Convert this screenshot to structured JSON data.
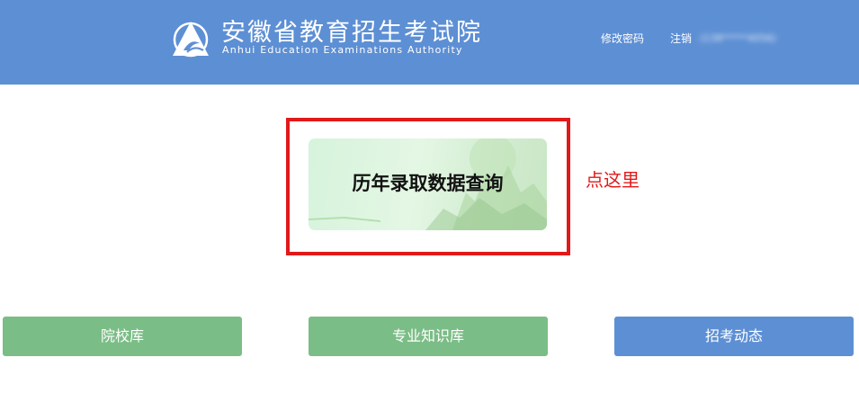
{
  "header": {
    "org_name_cn": "安徽省教育招生考试院",
    "org_name_en": "Anhui Education Examinations Authority",
    "change_password": "修改密码",
    "logout": "注销",
    "user_masked": "(138*****4056)",
    "bg_color": "#5d8fd4",
    "logo_icon": "triangle-logo-icon"
  },
  "main_card": {
    "title": "历年录取数据查询"
  },
  "annotation": {
    "text": "点这里",
    "color": "#e11919"
  },
  "nav_buttons": [
    {
      "label": "院校库",
      "color": "#7bbd86"
    },
    {
      "label": "专业知识库",
      "color": "#7bbd86"
    },
    {
      "label": "招考动态",
      "color": "#5d8fd4"
    }
  ]
}
